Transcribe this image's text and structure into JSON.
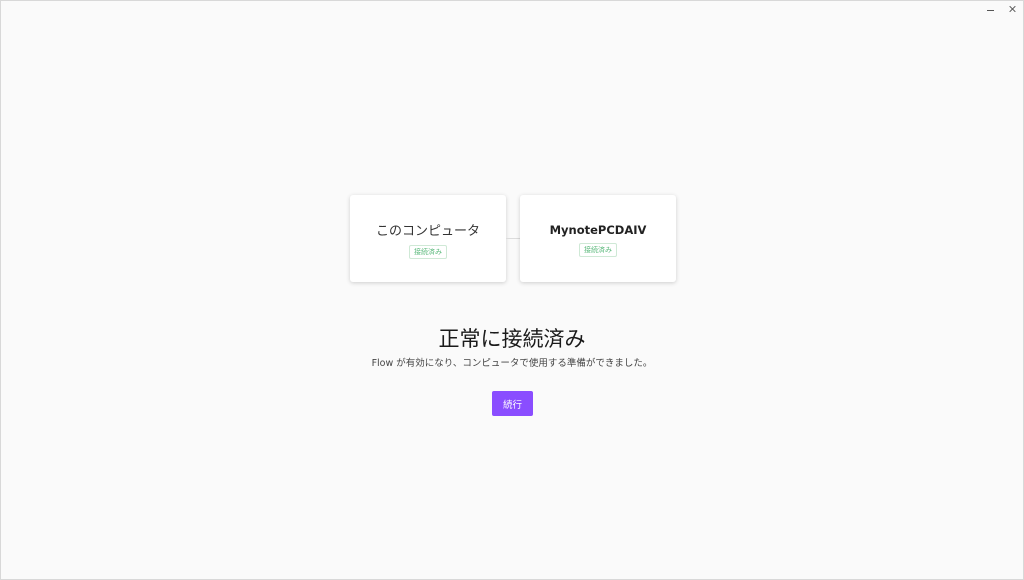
{
  "devices": {
    "this_computer": {
      "name": "このコンピュータ",
      "status": "接続済み"
    },
    "remote_computer": {
      "name": "MynotePCDAIV",
      "status": "接続済み"
    }
  },
  "main": {
    "heading": "正常に接続済み",
    "description": "Flow が有効になり、コンピュータで使用する準備ができました。",
    "continue_label": "続行"
  },
  "colors": {
    "accent": "#8a4dff",
    "status_green": "#59b87a"
  }
}
